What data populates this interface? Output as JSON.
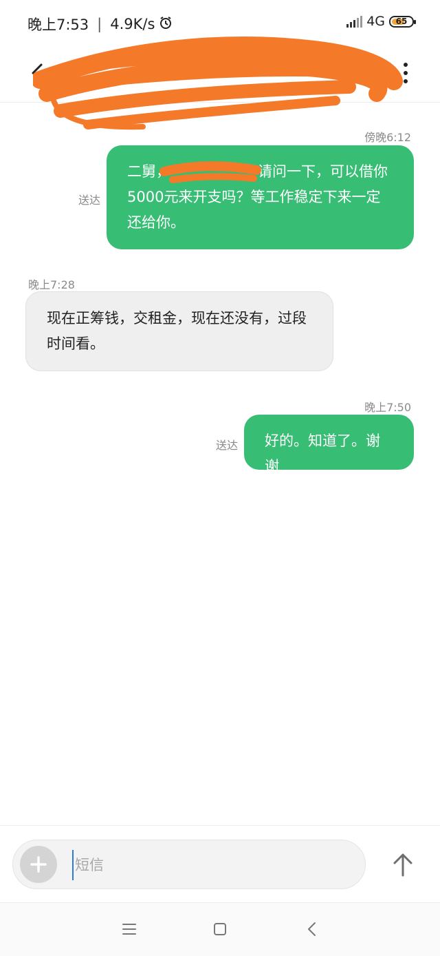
{
  "status_bar": {
    "time": "晚上7:53",
    "speed": "4.9K/s",
    "network": "4G",
    "battery": "65",
    "battery_level": 0.65
  },
  "header": {
    "contact_name": ""
  },
  "messages": [
    {
      "time": "傍晚6:12",
      "direction": "outgoing",
      "line1_head": "二舅，",
      "line1_tail": "请问一下，可以借你",
      "line2": "5000元来开支吗？等工作稳定下来一定",
      "line3": "还给你。",
      "status": "送达"
    },
    {
      "time": "晚上7:28",
      "direction": "incoming",
      "line1": "现在正筹钱，交租金，现在还没有，过段",
      "line2": "时间看。"
    },
    {
      "time": "晚上7:50",
      "direction": "outgoing",
      "text": "好的。知道了。谢谢",
      "status": "送达"
    }
  ],
  "composer": {
    "placeholder": "短信",
    "value": ""
  },
  "colors": {
    "outgoing_bubble": "#37bd74",
    "incoming_bubble": "#efefef",
    "redaction": "#f47a2a",
    "battery_fill": "#f2a640"
  },
  "icons": {
    "back": "chevron-left-icon",
    "more": "more-vertical-icon",
    "add": "plus-icon",
    "send": "arrow-up-icon",
    "alarm": "alarm-icon",
    "nav_menu": "menu-icon",
    "nav_home": "square-icon",
    "nav_back": "chevron-left-icon"
  }
}
